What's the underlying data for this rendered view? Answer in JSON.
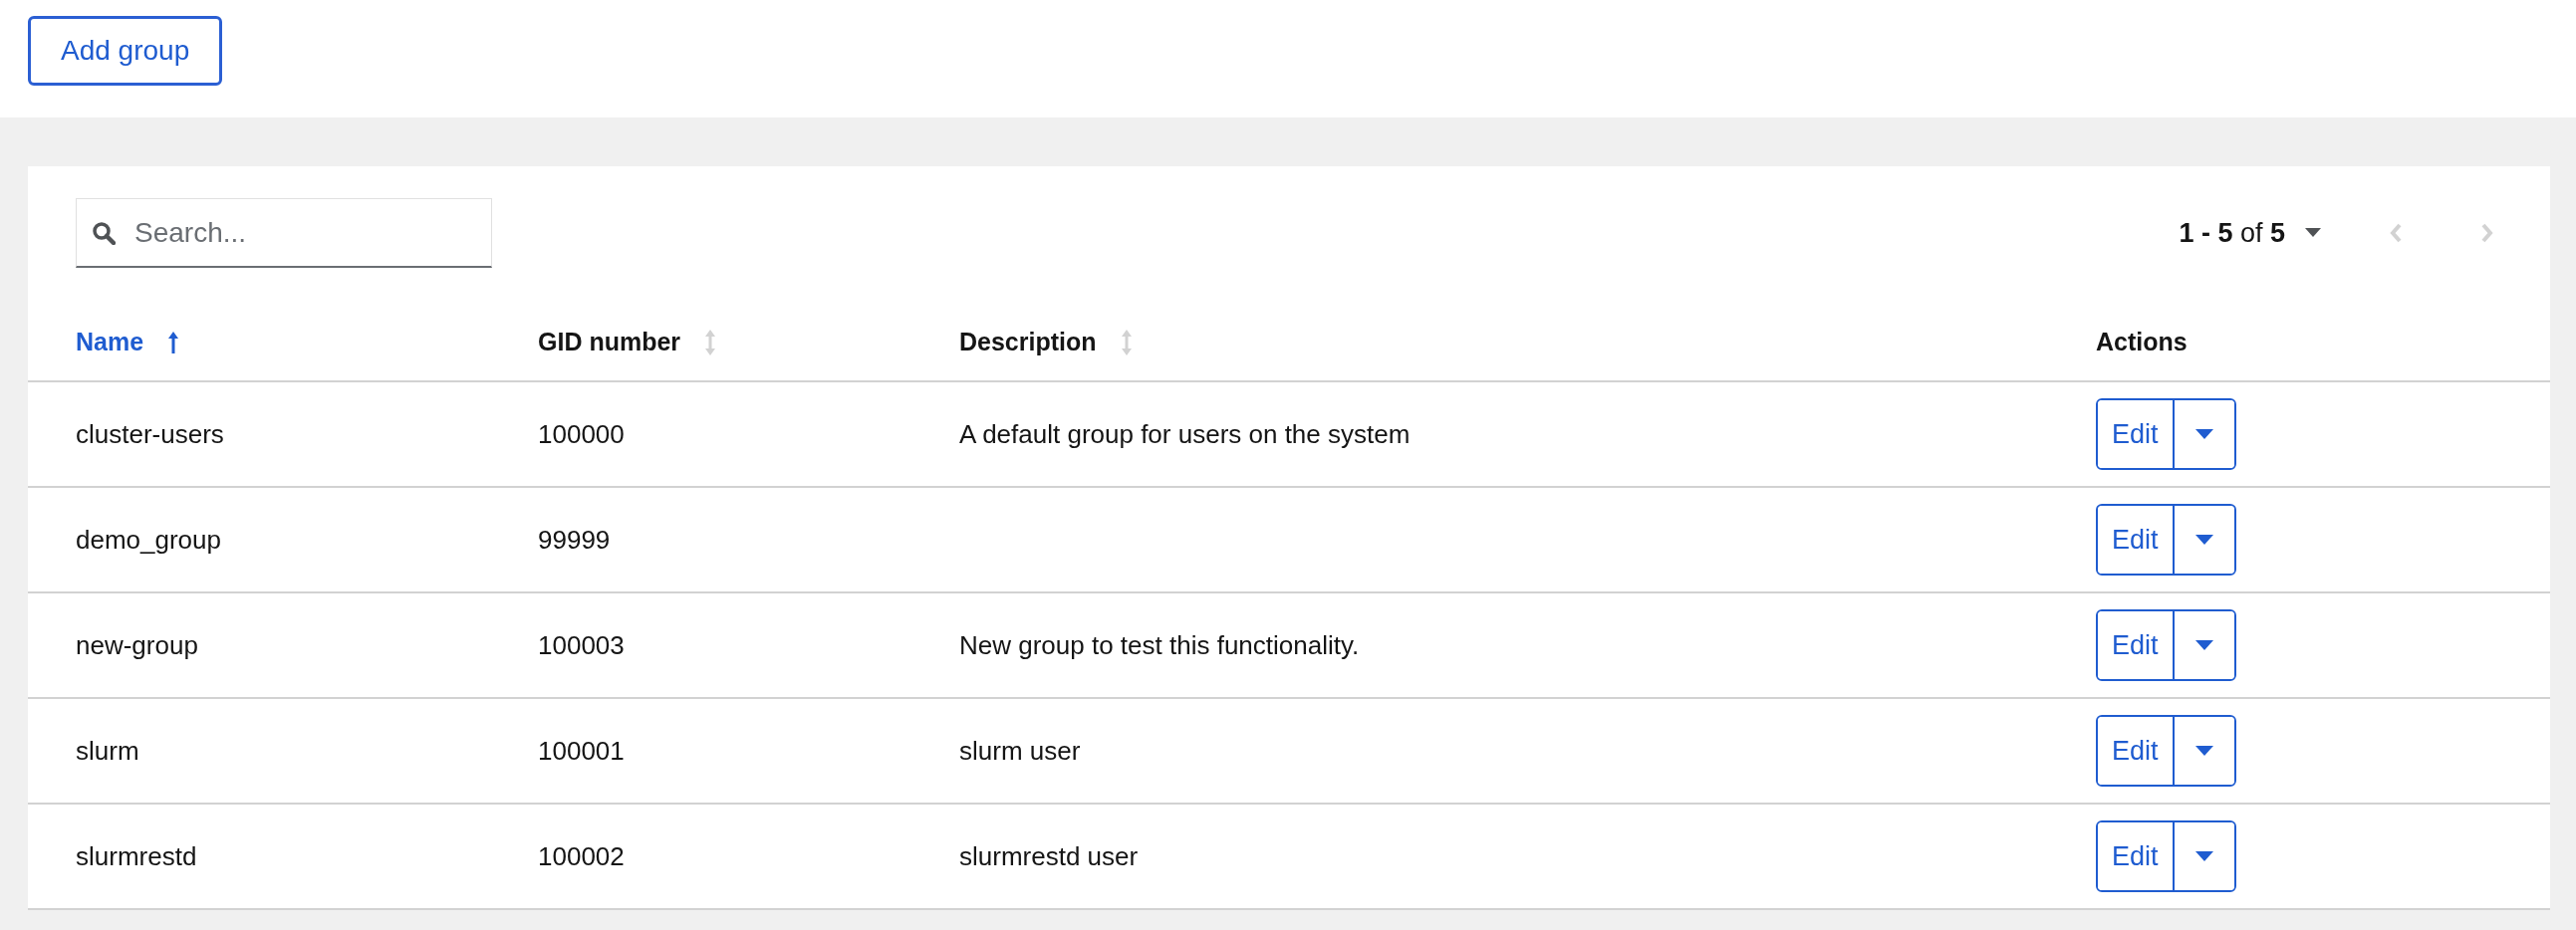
{
  "toolbar": {
    "add_button": "Add group"
  },
  "search": {
    "placeholder": "Search..."
  },
  "pagination": {
    "range": "**1 - 5** of **5**",
    "prev_disabled": true,
    "next_disabled": true
  },
  "table": {
    "columns": [
      {
        "label": "Name",
        "kind": "sortable",
        "sorted": true
      },
      {
        "label": "GID number",
        "kind": "sortable",
        "sorted": false
      },
      {
        "label": "Description",
        "kind": "sortable",
        "sorted": false
      },
      {
        "label": "Actions",
        "kind": "plain"
      }
    ],
    "rows": [
      {
        "name": "cluster-users",
        "gid": "100000",
        "description": "A default group for users on the system",
        "action": "Edit"
      },
      {
        "name": "demo_group",
        "gid": "99999",
        "action": "Edit"
      },
      {
        "name": "new-group",
        "gid": "100003",
        "description": "New group to test this functionality.",
        "action": "Edit"
      },
      {
        "name": "slurm",
        "gid": "100001",
        "description": "slurm user",
        "action": "Edit"
      },
      {
        "name": "slurmrestd",
        "gid": "100002",
        "description": "slurmrestd user",
        "action": "Edit"
      }
    ]
  }
}
